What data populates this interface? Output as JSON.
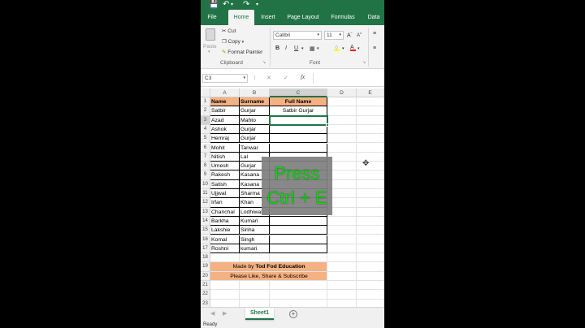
{
  "ribbon_tabs": [
    "File",
    "Home",
    "Insert",
    "Page Layout",
    "Formulas",
    "Data"
  ],
  "active_tab": "Home",
  "clipboard": {
    "paste": "Paste",
    "cut": "Cut",
    "copy": "Copy",
    "format_painter": "Format Painter",
    "group_label": "Clipboard"
  },
  "font": {
    "name": "Calibri",
    "size": "11",
    "bold": "B",
    "italic": "I",
    "underline": "U",
    "group_label": "Font"
  },
  "formula_bar": {
    "name_box": "C3",
    "fx": "fx",
    "value": ""
  },
  "columns": [
    "A",
    "B",
    "C",
    "D",
    "E"
  ],
  "selected_column": "C",
  "selected_row": 3,
  "row_numbers": [
    "1",
    "2",
    "3",
    "4",
    "5",
    "6",
    "7",
    "8",
    "9",
    "10",
    "11",
    "12",
    "13",
    "14",
    "15",
    "16",
    "17",
    "18",
    "19",
    "20",
    "21",
    "22",
    "23"
  ],
  "table": {
    "headers": [
      "Name",
      "Surname",
      "Full Name"
    ],
    "rows": [
      [
        "Satbir",
        "Gurjar",
        "Satbir Gurjar"
      ],
      [
        "Azad",
        "Mahto",
        ""
      ],
      [
        "Ashok",
        "Gurjar",
        ""
      ],
      [
        "Hemraj",
        "Gurjar",
        ""
      ],
      [
        "Mohit",
        "Tanwar",
        ""
      ],
      [
        "Nitish",
        "Lal",
        ""
      ],
      [
        "Umesh",
        "Gurjar",
        ""
      ],
      [
        "Rakesh",
        "Kasana",
        ""
      ],
      [
        "Satish",
        "Kasana",
        ""
      ],
      [
        "Ujjwal",
        "Sharma",
        ""
      ],
      [
        "Irfan",
        "Khan",
        ""
      ],
      [
        "Chanchal",
        "Lodhiwal",
        ""
      ],
      [
        "Barkha",
        "Kumari",
        ""
      ],
      [
        "Lakshie",
        "Sinha",
        ""
      ],
      [
        "Komal",
        "Singh",
        ""
      ],
      [
        "Roshni",
        "kumari",
        ""
      ]
    ]
  },
  "banner": {
    "line1_prefix": "Made by ",
    "line1_bold": "Tod Fod Education",
    "line2": "Please Like, Share & Subscribe"
  },
  "overlay": {
    "line1": "Press",
    "line2": "Ctrl + E",
    "text_color": "#00d400"
  },
  "sheet_tab": "Sheet1",
  "status": "Ready",
  "colors": {
    "excel_green": "#217346",
    "header_fill": "#f4b183"
  }
}
